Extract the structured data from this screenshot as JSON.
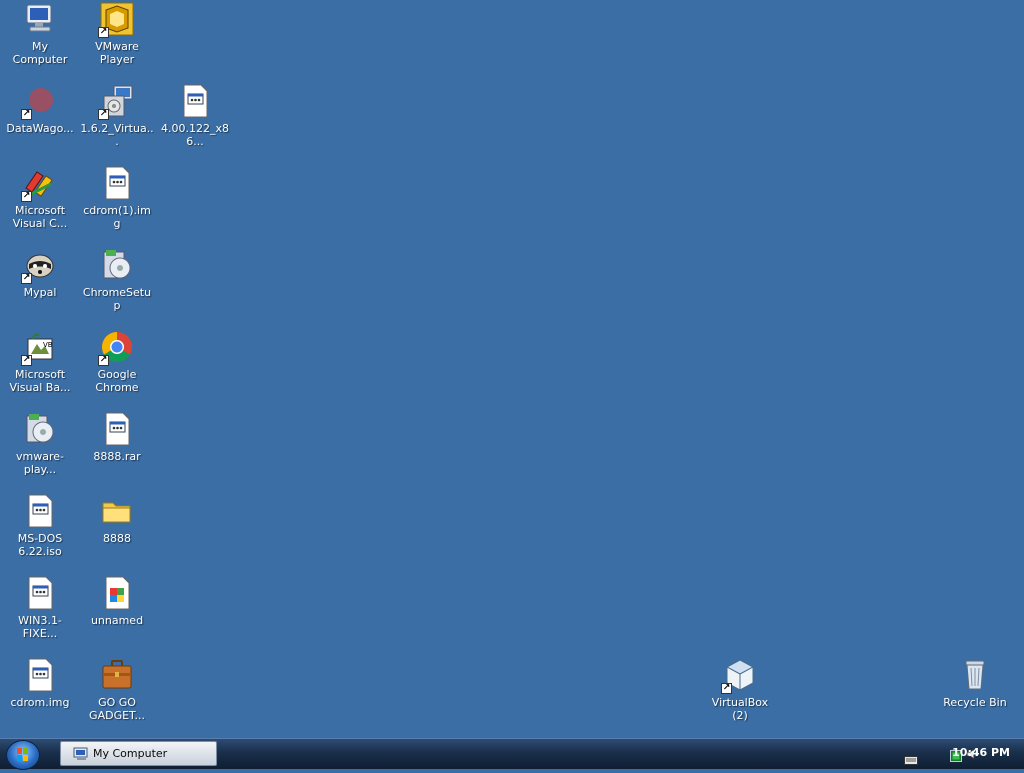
{
  "desktop": {
    "icons": [
      {
        "label": "My Computer"
      },
      {
        "label": "VMware Player"
      },
      {
        "label": "DataWago..."
      },
      {
        "label": "1.6.2_Virtua..."
      },
      {
        "label": "4.00.122_x86..."
      },
      {
        "label": "Microsoft Visual C..."
      },
      {
        "label": "cdrom(1).img"
      },
      {
        "label": "Mypal"
      },
      {
        "label": "ChromeSetup"
      },
      {
        "label": "Microsoft Visual Ba..."
      },
      {
        "label": "Google Chrome"
      },
      {
        "label": "vmware-play..."
      },
      {
        "label": "8888.rar"
      },
      {
        "label": "MS-DOS 6.22.iso"
      },
      {
        "label": "8888"
      },
      {
        "label": "WIN3.1-FIXE..."
      },
      {
        "label": "unnamed"
      },
      {
        "label": "cdrom.img"
      },
      {
        "label": "GO GO GADGET..."
      },
      {
        "label": "VirtualBox (2)"
      },
      {
        "label": "Recycle Bin"
      }
    ]
  },
  "taskbar": {
    "task_button_label": "My Computer",
    "clock": "10:46 PM"
  },
  "colors": {
    "desktop_background": "#3a6ea5",
    "taskbar": "#1a2f4a"
  }
}
